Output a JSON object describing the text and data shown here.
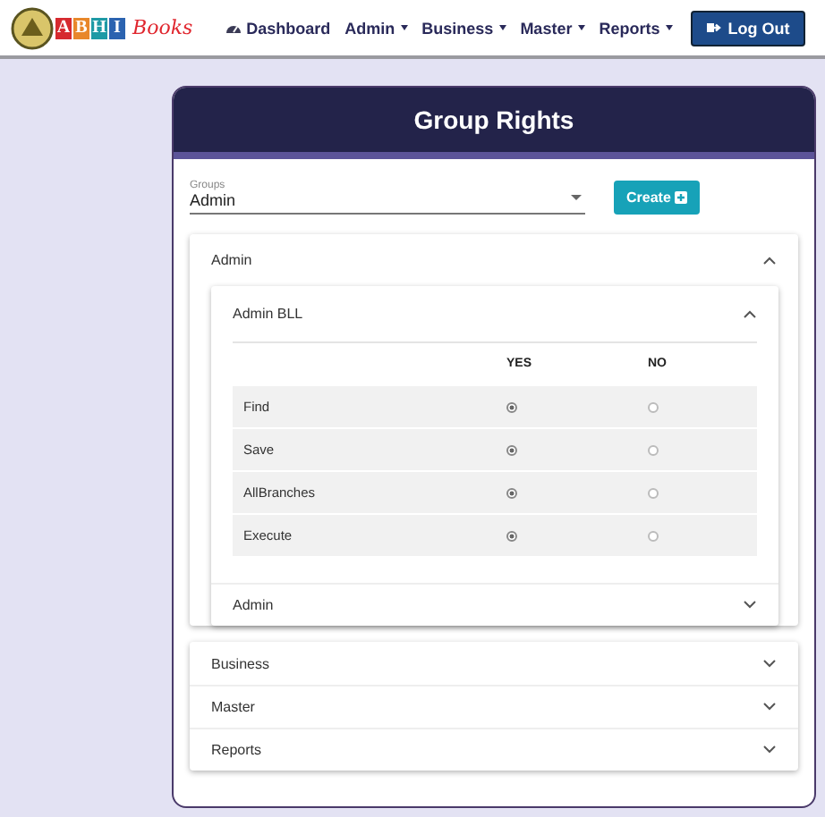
{
  "brand": {
    "letters": [
      {
        "text": "A",
        "color": "#d62a2f"
      },
      {
        "text": "B",
        "color": "#e8872a"
      },
      {
        "text": "H",
        "color": "#1e9aa5"
      },
      {
        "text": "I",
        "color": "#2b63b0"
      }
    ],
    "script": "Books"
  },
  "nav": {
    "items": [
      {
        "label": "Dashboard",
        "kind": "link"
      },
      {
        "label": "Admin",
        "kind": "dropdown"
      },
      {
        "label": "Business",
        "kind": "dropdown"
      },
      {
        "label": "Master",
        "kind": "dropdown"
      },
      {
        "label": "Reports",
        "kind": "dropdown"
      }
    ],
    "logout": "Log Out"
  },
  "card": {
    "title": "Group Rights",
    "groups_field": {
      "label": "Groups",
      "value": "Admin"
    },
    "create_button": "Create",
    "sections": [
      {
        "label": "Admin",
        "expanded": true,
        "subsections": [
          {
            "label": "Admin BLL",
            "expanded": true,
            "columns": [
              "YES",
              "NO"
            ],
            "rows": [
              {
                "name": "Find",
                "choices": [
                  {
                    "selected": true
                  },
                  {
                    "selected": false
                  }
                ]
              },
              {
                "name": "Save",
                "choices": [
                  {
                    "selected": true
                  },
                  {
                    "selected": false
                  }
                ]
              },
              {
                "name": "AllBranches",
                "choices": [
                  {
                    "selected": true
                  },
                  {
                    "selected": false
                  }
                ]
              },
              {
                "name": "Execute",
                "choices": [
                  {
                    "selected": true
                  },
                  {
                    "selected": false
                  }
                ]
              }
            ]
          },
          {
            "label": "Admin",
            "expanded": false
          }
        ]
      },
      {
        "label": "Business",
        "expanded": false
      },
      {
        "label": "Master",
        "expanded": false
      },
      {
        "label": "Reports",
        "expanded": false
      }
    ]
  }
}
